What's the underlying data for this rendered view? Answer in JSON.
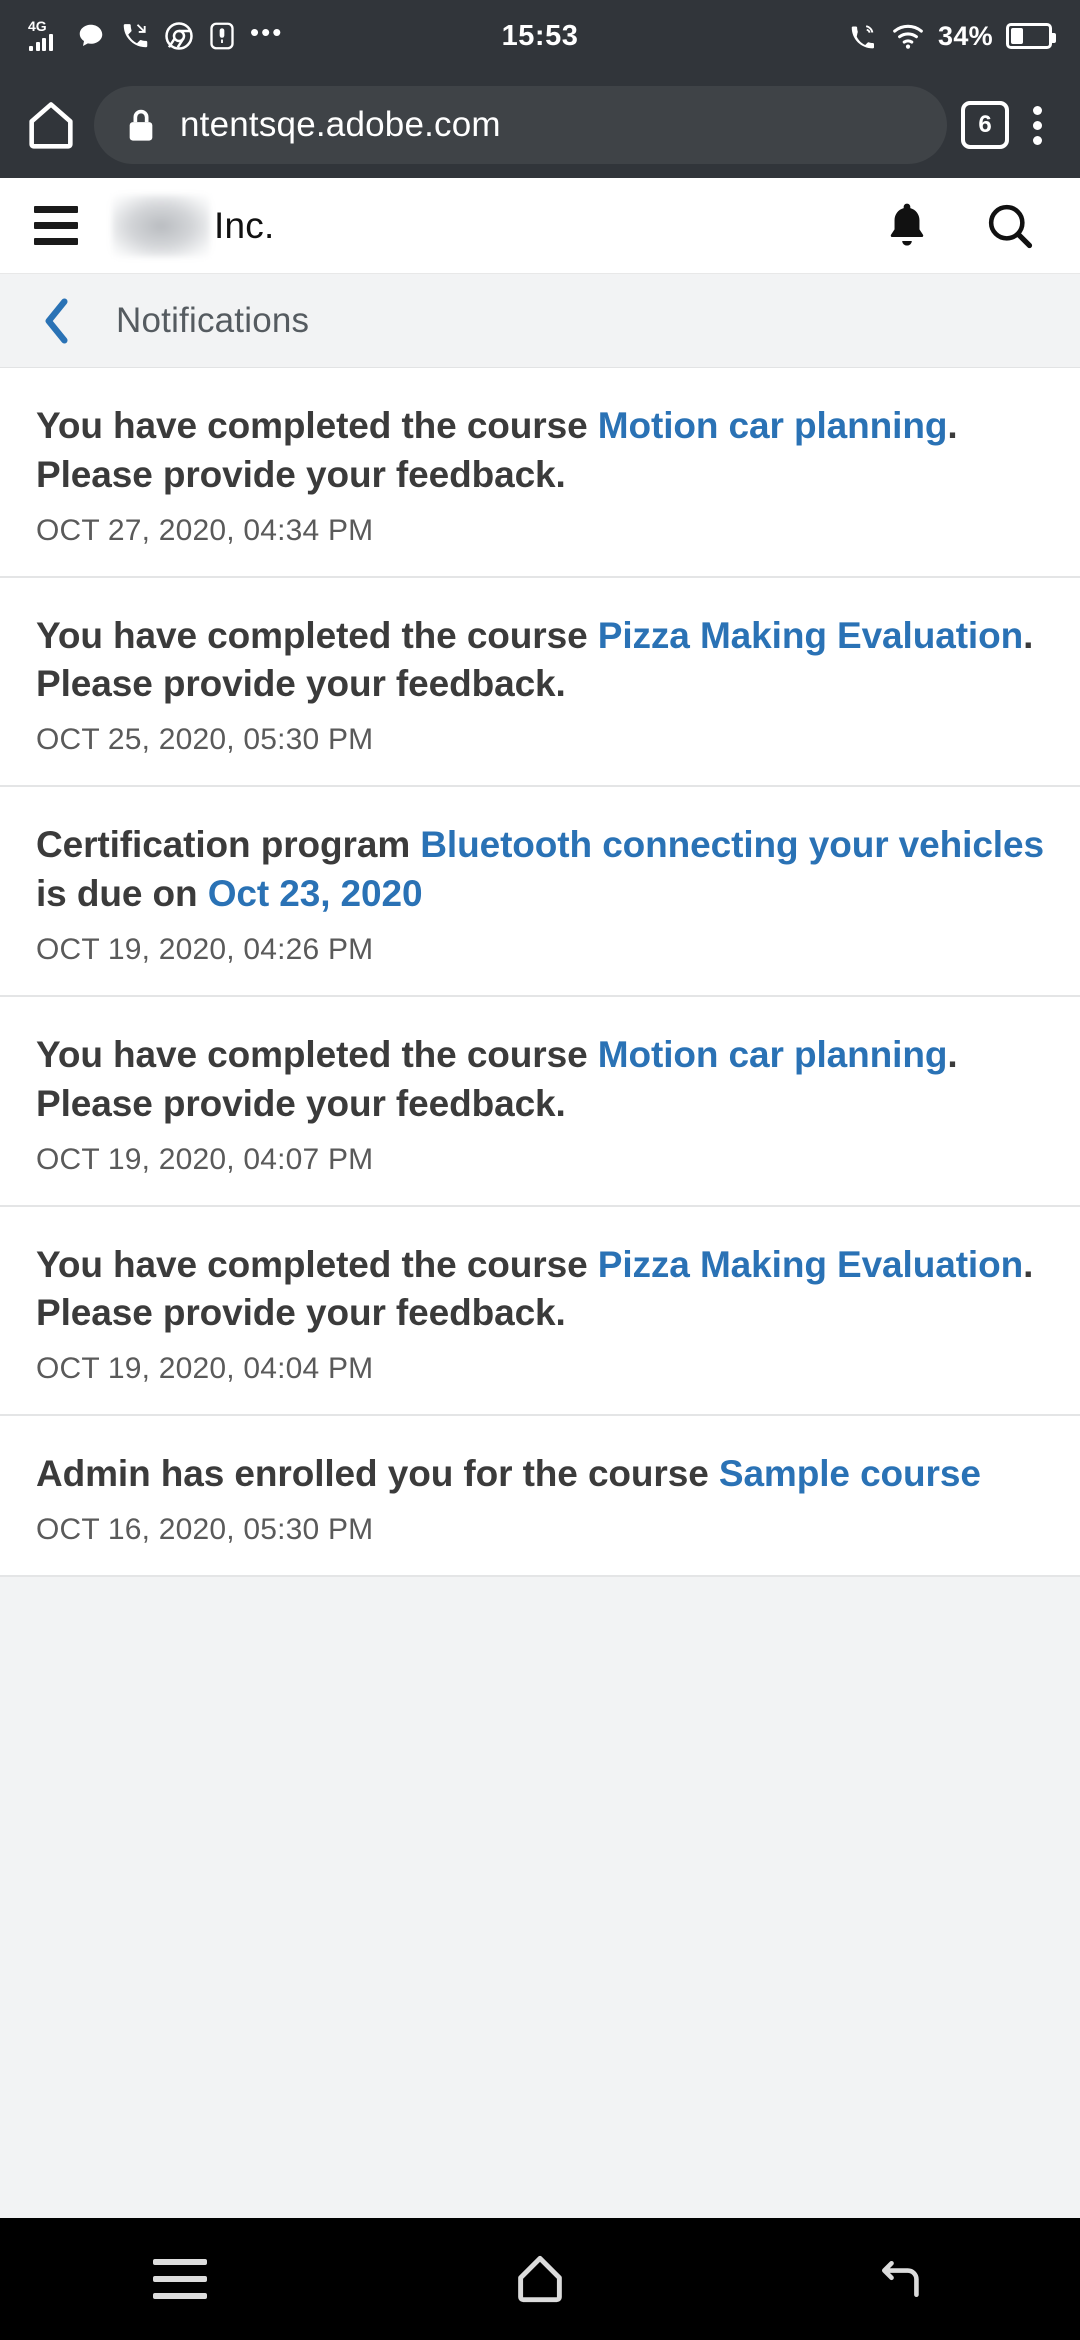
{
  "status_bar": {
    "network_label": "4G",
    "time": "15:53",
    "battery_percent": "34%",
    "overflow_dots": "•••",
    "icons": [
      "signal-icon",
      "message-icon",
      "missed-call-icon",
      "chrome-icon",
      "voice-recorder-icon",
      "overflow-icon",
      "call-wifi-icon",
      "wifi-icon",
      "battery-icon"
    ]
  },
  "browser": {
    "url": "ntentsqe.adobe.com",
    "tab_count": "6",
    "home_icon": "home-icon",
    "lock_icon": "lock-icon",
    "menu_icon": "kebab-menu-icon"
  },
  "app_header": {
    "menu_icon": "hamburger-menu-icon",
    "brand_name": "Inc.",
    "notifications_icon": "bell-icon",
    "search_icon": "search-icon"
  },
  "sub_header": {
    "back_icon": "chevron-left-icon",
    "title": "Notifications"
  },
  "notifications": [
    {
      "segments": [
        {
          "text": "You have completed the course ",
          "link": false
        },
        {
          "text": "Motion car planning",
          "link": true
        },
        {
          "text": ". Please provide your feedback.",
          "link": false
        }
      ],
      "timestamp": "OCT 27, 2020, 04:34 PM"
    },
    {
      "segments": [
        {
          "text": "You have completed the course ",
          "link": false
        },
        {
          "text": "Pizza Making Evaluation",
          "link": true
        },
        {
          "text": ". Please provide your feedback.",
          "link": false
        }
      ],
      "timestamp": "OCT 25, 2020, 05:30 PM"
    },
    {
      "segments": [
        {
          "text": "Certification program ",
          "link": false
        },
        {
          "text": "Bluetooth connecting your vehicles",
          "link": true
        },
        {
          "text": " is due on ",
          "link": false
        },
        {
          "text": "Oct 23, 2020",
          "link": true
        }
      ],
      "timestamp": "OCT 19, 2020, 04:26 PM"
    },
    {
      "segments": [
        {
          "text": "You have completed the course ",
          "link": false
        },
        {
          "text": "Motion car planning",
          "link": true
        },
        {
          "text": ". Please provide your feedback.",
          "link": false
        }
      ],
      "timestamp": "OCT 19, 2020, 04:07 PM"
    },
    {
      "segments": [
        {
          "text": "You have completed the course ",
          "link": false
        },
        {
          "text": "Pizza Making Evaluation",
          "link": true
        },
        {
          "text": ". Please provide your feedback.",
          "link": false
        }
      ],
      "timestamp": "OCT 19, 2020, 04:04 PM"
    },
    {
      "segments": [
        {
          "text": "Admin has enrolled you for the course ",
          "link": false
        },
        {
          "text": "Sample course",
          "link": true
        }
      ],
      "timestamp": "OCT 16, 2020, 05:30 PM"
    }
  ],
  "nav_bar": {
    "recents_icon": "recents-icon",
    "home_icon": "home-icon",
    "back_icon": "back-icon"
  },
  "colors": {
    "link": "#2a72b5",
    "chrome_bar": "#31353a",
    "url_pill": "#3f4347",
    "page_bg": "#f2f3f4",
    "card_bg": "#ffffff",
    "body_text": "#3b3b3b",
    "muted_text": "#5a5a5a",
    "nav_bar": "#000000"
  }
}
